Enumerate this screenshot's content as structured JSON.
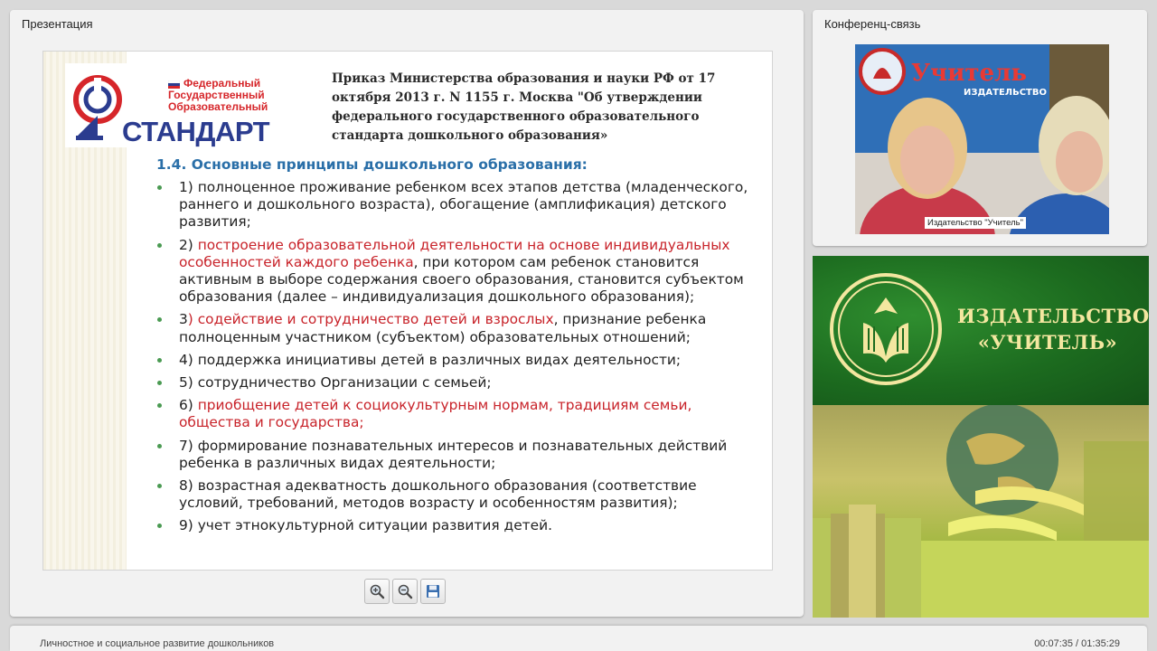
{
  "presentation_panel": {
    "title": "Презентация",
    "slide": {
      "logo": {
        "lines": [
          "Федеральный",
          "Государственный",
          "Образовательный"
        ],
        "word": "СТАНДАРТ"
      },
      "heading": "Приказ Министерства образования и науки РФ от 17 октября 2013 г. N 1155 г. Москва \"Об утверждении федерального государственного образовательного стандарта дошкольного образования»",
      "principles_title": "1.4. Основные принципы дошкольного образования:",
      "items": [
        {
          "before": "1) полноценное проживание ребенком всех этапов детства (младенческого, раннего и дошкольного возраста), обогащение (амплификация) детского развития;",
          "highlight": "",
          "after": ""
        },
        {
          "before": "2) ",
          "highlight": "построение образовательной деятельности на основе индивидуальных особенностей каждого ребенка",
          "after": ", при котором сам ребенок становится активным в выборе содержания своего образования, становится субъектом образования (далее – индивидуализация дошкольного образования);"
        },
        {
          "before": "3",
          "highlight": ") содействие и сотрудничество детей и взрослых",
          "after": ", признание ребенка полноценным участником (субъектом) образовательных отношений;"
        },
        {
          "before": "4) поддержка инициативы детей в различных видах деятельности;",
          "highlight": "",
          "after": ""
        },
        {
          "before": "5) сотрудничество Организации с семьей;",
          "highlight": "",
          "after": ""
        },
        {
          "before": "6) ",
          "highlight": "приобщение детей к социокультурным нормам, традициям семьи, общества и государства;",
          "after": ""
        },
        {
          "before": "7) формирование познавательных интересов и познавательных действий ребенка в различных видах деятельности;",
          "highlight": "",
          "after": ""
        },
        {
          "before": "8) возрастная адекватность дошкольного образования (соответствие условий, требований, методов возрасту и особенностям развития);",
          "highlight": "",
          "after": ""
        },
        {
          "before": "9) учет этнокультурной ситуации развития детей.",
          "highlight": "",
          "after": ""
        }
      ]
    },
    "toolbar": {
      "zoom_in_icon": "zoom-in-icon",
      "zoom_out_icon": "zoom-out-icon",
      "save_icon": "floppy-disk-icon"
    }
  },
  "conference_panel": {
    "title": "Конференц-связь",
    "video_label": "Издательство \"Учитель\"",
    "backdrop_text": "Учитель",
    "backdrop_subtext": "ИЗДАТЕЛЬСТВО"
  },
  "banner": {
    "name_line1": "ИЗДАТЕЛЬСТВО",
    "name_line2": "«УЧИТЕЛЬ»"
  },
  "footer": {
    "title": "Личностное и социальное развитие дошкольников",
    "time": "00:07:35 / 01:35:29"
  },
  "colors": {
    "accent_red": "#c8232a",
    "title_blue": "#2a6fa8",
    "banner_green": "#1c6b1f",
    "banner_gold": "#f4e7a0"
  }
}
